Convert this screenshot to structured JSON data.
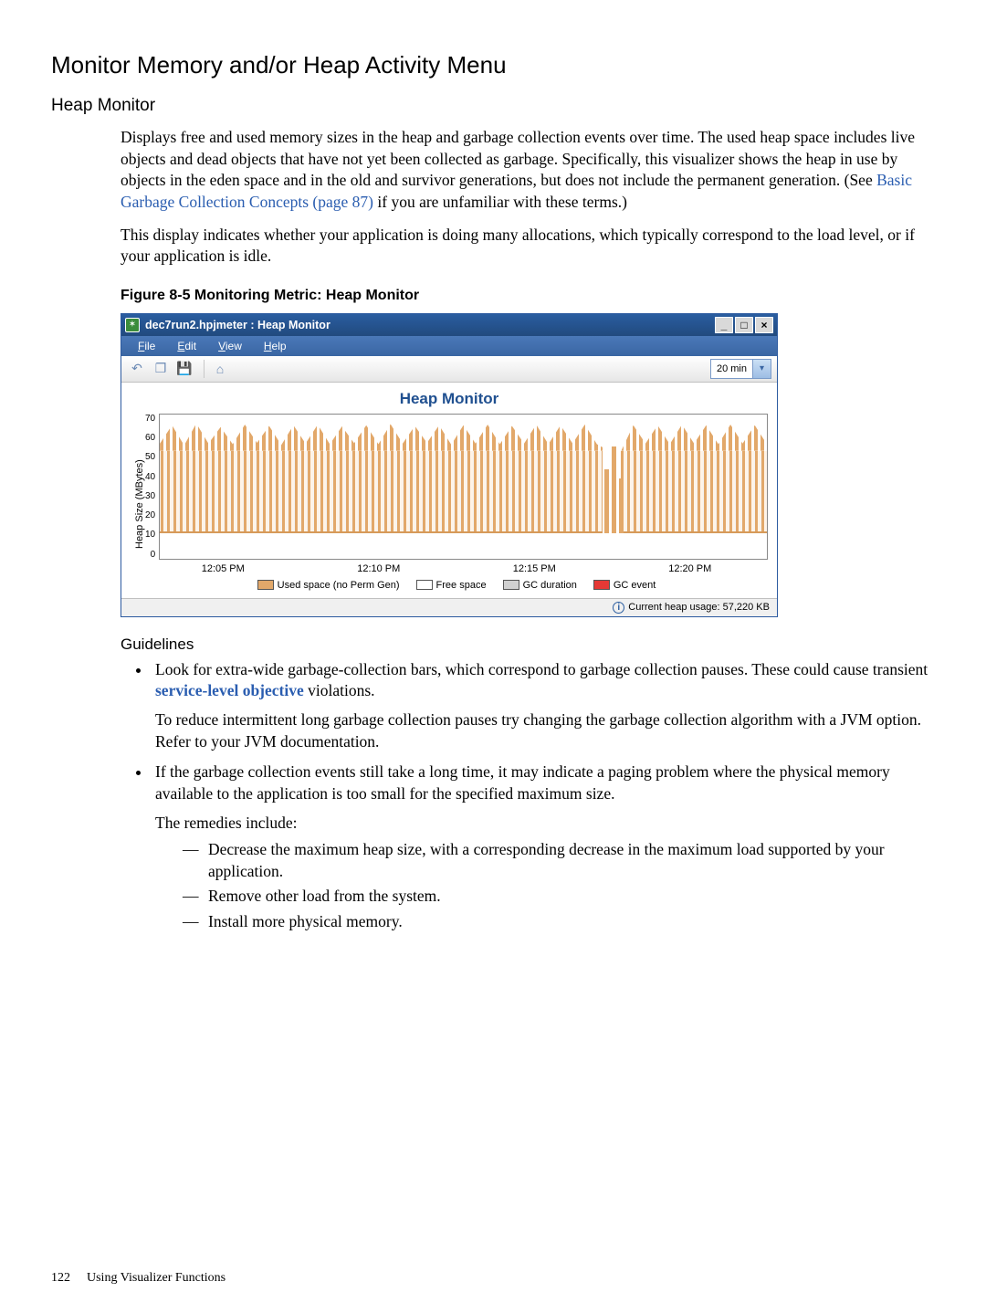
{
  "headings": {
    "h1": "Monitor Memory and/or Heap Activity Menu",
    "h2": "Heap Monitor",
    "guidelines": "Guidelines"
  },
  "paragraphs": {
    "p1a": "Displays free and used memory sizes in the heap and garbage collection events over time. The used heap space includes live objects and dead objects that have not yet been collected as garbage. Specifically, this visualizer shows the heap in use by objects in the eden space and in the old and survivor generations, but does not include the permanent generation. (See ",
    "p1_link": "Basic Garbage Collection Concepts (page 87)",
    "p1b": " if you are unfamiliar with these terms.)",
    "p2": "This display indicates whether your application is doing many allocations, which typically correspond to the load level, or if your application is idle."
  },
  "figure_caption": "Figure 8-5 Monitoring Metric: Heap Monitor",
  "app": {
    "title": "dec7run2.hpjmeter : Heap Monitor",
    "menus": {
      "file": "File",
      "edit": "Edit",
      "view": "View",
      "help": "Help"
    },
    "time_range": "20 min",
    "chart_title": "Heap Monitor",
    "y_label": "Heap Size (MBytes)",
    "y_ticks": [
      "70",
      "60",
      "50",
      "40",
      "30",
      "20",
      "10",
      "0"
    ],
    "x_ticks": [
      "12:05 PM",
      "12:10 PM",
      "12:15 PM",
      "12:20 PM"
    ],
    "legend": {
      "used": "Used space (no Perm Gen)",
      "free": "Free space",
      "gcd": "GC duration",
      "gce": "GC event"
    },
    "status": "Current heap usage: 57,220 KB"
  },
  "guidelines": {
    "b1a": "Look for extra-wide garbage-collection bars, which correspond to garbage collection pauses. These could cause transient ",
    "b1_term": "service-level objective",
    "b1b": " violations.",
    "b1p2": "To reduce intermittent long garbage collection pauses try changing the garbage collection algorithm with a JVM option. Refer to your JVM documentation.",
    "b2": "If the garbage collection events still take a long time, it may indicate a paging problem where the physical memory available to the application is too small for the specified maximum size.",
    "b2p2": "The remedies include:",
    "r1": "Decrease the maximum heap size, with a corresponding decrease in the maximum load supported by your application.",
    "r2": "Remove other load from the system.",
    "r3": "Install more physical memory."
  },
  "footer": {
    "page": "122",
    "section": "Using Visualizer Functions"
  },
  "chart_data": {
    "type": "area",
    "title": "Heap Monitor",
    "ylabel": "Heap Size (MBytes)",
    "ylim": [
      0,
      75
    ],
    "x_range": [
      "12:03 PM",
      "12:22 PM"
    ],
    "series": [
      {
        "name": "Used space (no Perm Gen)",
        "approx_range_mb": [
          50,
          70
        ],
        "behavior": "sawtooth oscillation between ~50 and ~70 MB across full window, brief drop near 12:17 PM"
      },
      {
        "name": "Free space",
        "approx_range_mb": [
          5,
          25
        ]
      },
      {
        "name": "GC duration",
        "approx_range_mb": [
          0,
          2
        ]
      },
      {
        "name": "GC event",
        "note": "instantaneous markers"
      }
    ],
    "status_value_kb": 57220
  }
}
